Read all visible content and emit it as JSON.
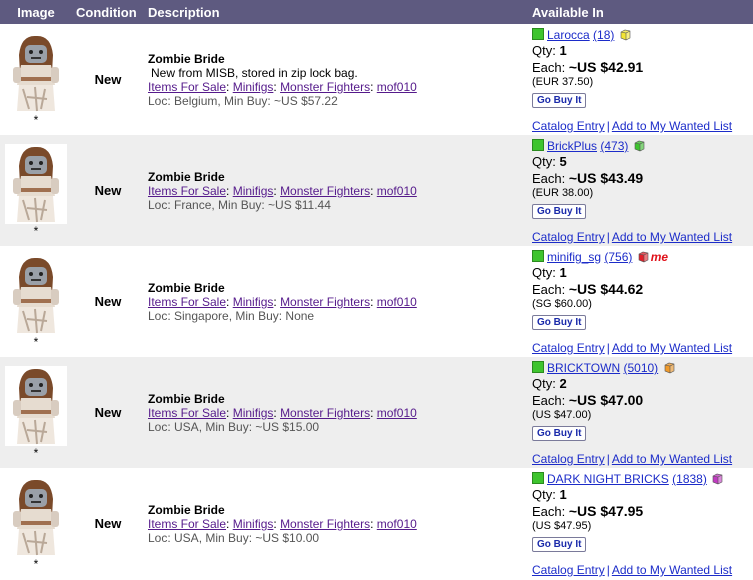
{
  "headers": {
    "image": "Image",
    "condition": "Condition",
    "description": "Description",
    "available": "Available In"
  },
  "listings": [
    {
      "condition": "New",
      "title": "Zombie Bride",
      "note": "New from MISB, stored in zip lock bag.",
      "categories": [
        "Items For Sale",
        "Minifigs",
        "Monster Fighters",
        "mof010"
      ],
      "location": "Loc: Belgium, Min Buy: ~US $57.22",
      "store": "Larocca",
      "feedback": "(18)",
      "box_color": "#f2e534",
      "me": "",
      "qty_label": "Qty: ",
      "qty": "1",
      "each_label": "Each: ",
      "price": "~US $42.91",
      "orig_price": "(EUR 37.50)"
    },
    {
      "condition": "New",
      "title": "Zombie Bride",
      "note": "",
      "categories": [
        "Items For Sale",
        "Minifigs",
        "Monster Fighters",
        "mof010"
      ],
      "location": "Loc: France, Min Buy: ~US $11.44",
      "store": "BrickPlus",
      "feedback": "(473)",
      "box_color": "#3ec42e",
      "me": "",
      "qty_label": "Qty: ",
      "qty": "5",
      "each_label": "Each: ",
      "price": "~US $43.49",
      "orig_price": "(EUR 38.00)"
    },
    {
      "condition": "New",
      "title": "Zombie Bride",
      "note": "",
      "categories": [
        "Items For Sale",
        "Minifigs",
        "Monster Fighters",
        "mof010"
      ],
      "location": "Loc: Singapore, Min Buy: None",
      "store": "minifig_sg",
      "feedback": "(756)",
      "box_color": "#e0202a",
      "me": "me",
      "qty_label": "Qty: ",
      "qty": "1",
      "each_label": "Each: ",
      "price": "~US $44.62",
      "orig_price": "(SG $60.00)"
    },
    {
      "condition": "New",
      "title": "Zombie Bride",
      "note": "",
      "categories": [
        "Items For Sale",
        "Minifigs",
        "Monster Fighters",
        "mof010"
      ],
      "location": "Loc: USA, Min Buy: ~US $15.00",
      "store": "BRICKTOWN",
      "feedback": "(5010)",
      "box_color": "#f09a2a",
      "me": "",
      "qty_label": "Qty: ",
      "qty": "2",
      "each_label": "Each: ",
      "price": "~US $47.00",
      "orig_price": "(US $47.00)"
    },
    {
      "condition": "New",
      "title": "Zombie Bride",
      "note": "",
      "categories": [
        "Items For Sale",
        "Minifigs",
        "Monster Fighters",
        "mof010"
      ],
      "location": "Loc: USA, Min Buy: ~US $10.00",
      "store": "DARK NIGHT BRICKS",
      "feedback": "(1838)",
      "box_color": "#c13ac1",
      "me": "",
      "qty_label": "Qty: ",
      "qty": "1",
      "each_label": "Each: ",
      "price": "~US $47.95",
      "orig_price": "(US $47.95)"
    }
  ],
  "common": {
    "star": "*",
    "buy_label": "Go Buy It",
    "catalog_link": "Catalog Entry",
    "wanted_link": "Add to My Wanted List",
    "link_sep": "|"
  }
}
